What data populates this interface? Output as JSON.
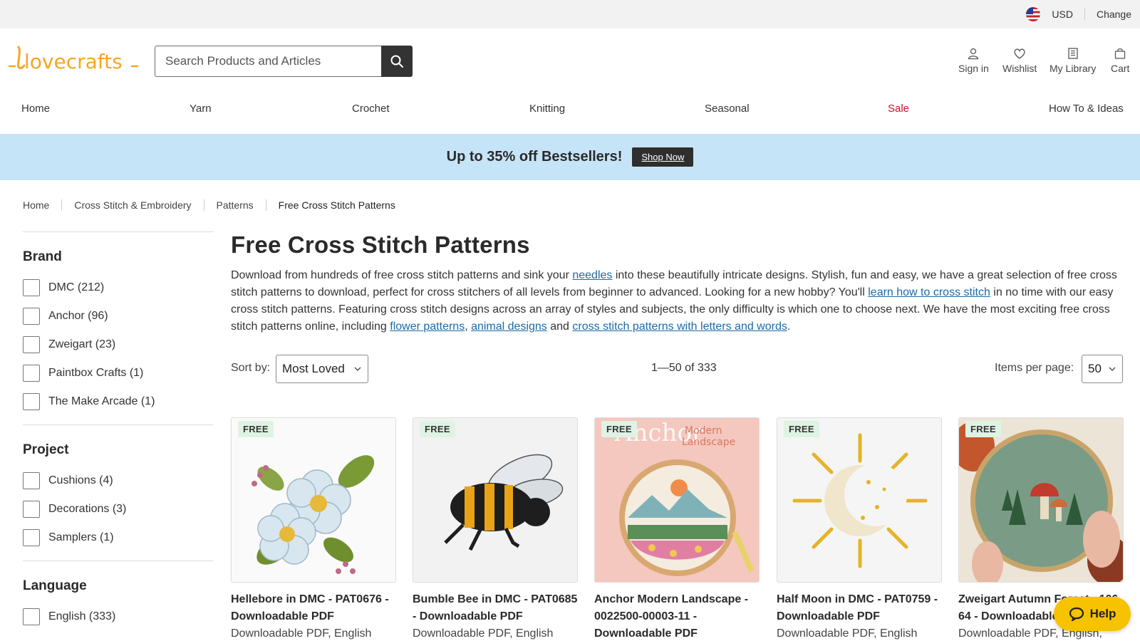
{
  "topbar": {
    "currency": "USD",
    "change_label": "Change",
    "flag_icon": "us-flag-icon"
  },
  "header": {
    "logo_text": "lovecrafts",
    "search": {
      "placeholder": "Search Products and Articles",
      "value": "",
      "button_icon": "search-icon"
    },
    "account": [
      {
        "label": "Sign in",
        "icon": "user-icon"
      },
      {
        "label": "Wishlist",
        "icon": "heart-icon"
      },
      {
        "label": "My Library",
        "icon": "library-icon"
      },
      {
        "label": "Cart",
        "icon": "bag-icon"
      }
    ]
  },
  "nav": {
    "items": [
      {
        "label": "Home"
      },
      {
        "label": "Yarn"
      },
      {
        "label": "Crochet"
      },
      {
        "label": "Knitting"
      },
      {
        "label": "Seasonal"
      },
      {
        "label": "Sale"
      },
      {
        "label": "How To & Ideas"
      }
    ],
    "sale_color": "#c8102e"
  },
  "promo": {
    "text": "Up to 35% off Bestsellers!",
    "cta": "Shop Now",
    "background": "#c6e4f8"
  },
  "breadcrumb": [
    "Home",
    "Cross Stitch & Embroidery",
    "Patterns",
    "Free Cross Stitch Patterns"
  ],
  "filters": [
    {
      "title": "Brand",
      "options": [
        {
          "label": "DMC (212)",
          "checked": false
        },
        {
          "label": "Anchor (96)",
          "checked": false
        },
        {
          "label": "Zweigart (23)",
          "checked": false
        },
        {
          "label": "Paintbox Crafts (1)",
          "checked": false
        },
        {
          "label": "The Make Arcade (1)",
          "checked": false
        }
      ]
    },
    {
      "title": "Project",
      "options": [
        {
          "label": "Cushions (4)",
          "checked": false
        },
        {
          "label": "Decorations (3)",
          "checked": false
        },
        {
          "label": "Samplers (1)",
          "checked": false
        }
      ]
    },
    {
      "title": "Language",
      "options": [
        {
          "label": "English (333)",
          "checked": false
        }
      ]
    }
  ],
  "page": {
    "title": "Free Cross Stitch Patterns",
    "intro": {
      "t1": "Download from hundreds of free cross stitch patterns and sink your ",
      "link_needles": "needles",
      "t2": " into these beautifully intricate designs. Stylish, fun and easy, we have a great selection of free cross stitch patterns to download, perfect for cross stitchers of all levels from beginner to advanced. Looking for a new hobby? You'll ",
      "link_learn": "learn how to cross stitch",
      "t3": " in no time with our easy cross stitch patterns. Featuring cross stitch designs across an array of styles and subjects, the only difficulty is which one to choose next. We have the most exciting free cross stitch patterns online, including ",
      "link_flower": "flower patterns",
      "t4": ", ",
      "link_animal": "animal designs",
      "t5": " and ",
      "link_letters": "cross stitch patterns with letters and words",
      "t6": "."
    },
    "link_color": "#1a6aa8"
  },
  "toolbar": {
    "sort_label": "Sort by:",
    "sort_value": "Most Loved",
    "result_count": "1—50 of 333",
    "ipp_label": "Items per page:",
    "ipp_value": "50"
  },
  "products": [
    {
      "badge": "FREE",
      "title": "Hellebore in DMC - PAT0676 - Downloadable PDF",
      "meta": "Downloadable PDF, English"
    },
    {
      "badge": "FREE",
      "title": "Bumble Bee in DMC - PAT0685 - Downloadable PDF",
      "meta": "Downloadable PDF, English"
    },
    {
      "badge": "FREE",
      "title": "Anchor Modern Landscape - 0022500-00003-11 - Downloadable PDF",
      "meta": "",
      "image_text_1": "Anchor",
      "image_text_2": "Modern",
      "image_text_3": "Landscape"
    },
    {
      "badge": "FREE",
      "title": "Half Moon in DMC - PAT0759 - Downloadable PDF",
      "meta": "Downloadable PDF, English"
    },
    {
      "badge": "FREE",
      "title": "Zweigart Autumn Forest - 106-64 - Downloadable PDF",
      "meta": "Downloadable PDF, English,"
    }
  ],
  "help": {
    "label": "Help",
    "icon": "chat-bubble-icon",
    "color": "#f7c200"
  }
}
